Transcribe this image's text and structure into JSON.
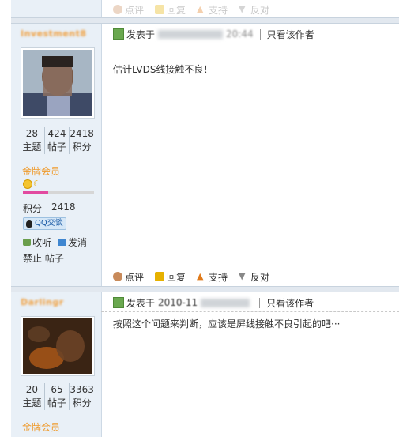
{
  "actions_top": {
    "rate": "点评",
    "reply": "回复",
    "support": "支持",
    "oppose": "反对"
  },
  "post1": {
    "username": "Investment8",
    "stats": [
      {
        "value": "28",
        "label": "主题"
      },
      {
        "value": "424",
        "label": "帖子"
      },
      {
        "value": "2418",
        "label": "积分"
      }
    ],
    "rank": "金牌会员",
    "points_label": "积分",
    "points_value": "2418",
    "qq_label": "QQ交谈",
    "listen_label": "收听",
    "message_label": "发消",
    "ban_label": "禁止 帖子",
    "posted_label": "发表于",
    "time_suffix": "20:44",
    "only_author": "只看该作者",
    "content": "估计LVDS线接触不良！",
    "actions": {
      "rate": "点评",
      "reply": "回复",
      "support": "支持",
      "oppose": "反对"
    }
  },
  "post2": {
    "username": "Darlingr",
    "stats": [
      {
        "value": "20",
        "label": "主题"
      },
      {
        "value": "65",
        "label": "帖子"
      },
      {
        "value": "3363",
        "label": "积分"
      }
    ],
    "rank": "金牌会员",
    "posted_label": "发表于",
    "time_prefix": "2010-11",
    "only_author": "只看该作者",
    "content": "按照这个问题来判断，应该是屏线接触不良引起的吧···"
  },
  "colors": {
    "sidebar_bg": "#e9f0f7",
    "rank": "#ef9a2b",
    "post_icon": "#6aa84f"
  }
}
